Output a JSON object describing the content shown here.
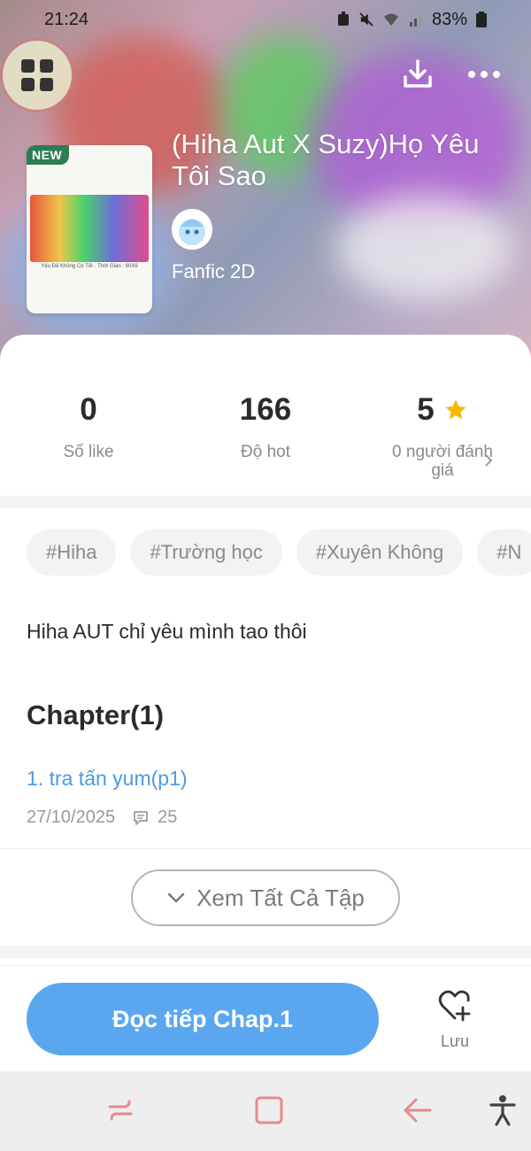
{
  "status_bar": {
    "time": "21:24",
    "battery": "83%"
  },
  "hero": {
    "title": "(Hiha Aut X Suzy)Họ Yêu Tôi Sao",
    "badge": "NEW",
    "genre": "Fanfic 2D",
    "cover_caption": "Yêu Đế Không Có Tết - Thời Gian : 60X6"
  },
  "stats": [
    {
      "value": "0",
      "label": "Số like"
    },
    {
      "value": "166",
      "label": "Độ hot"
    },
    {
      "value": "5",
      "label": "0 người đánh giá"
    }
  ],
  "tags": [
    "#Hiha",
    "#Trường học",
    "#Xuyên Không",
    "#N"
  ],
  "description": "Hiha AUT chỉ yêu mình tao thôi",
  "chapters": {
    "heading": "Chapter(1)",
    "items": [
      {
        "title": "1. tra tấn yum(p1)",
        "date": "27/10/2025",
        "comments": "25"
      }
    ]
  },
  "see_all_label": "Xem Tất Cả Tập",
  "read_button_label": "Đọc tiếp Chap.1",
  "save_label": "Lưu",
  "colors": {
    "accent": "#5aa7f0",
    "link": "#4a9ae0",
    "star": "#f5b800",
    "badge": "#2e7d52"
  },
  "icons": [
    "grid-menu-icon",
    "download-icon",
    "more-icon",
    "star-icon",
    "chevron-right-icon",
    "comment-icon",
    "chevron-down-icon",
    "heart-plus-icon",
    "recents-icon",
    "home-icon",
    "back-icon",
    "accessibility-icon"
  ]
}
